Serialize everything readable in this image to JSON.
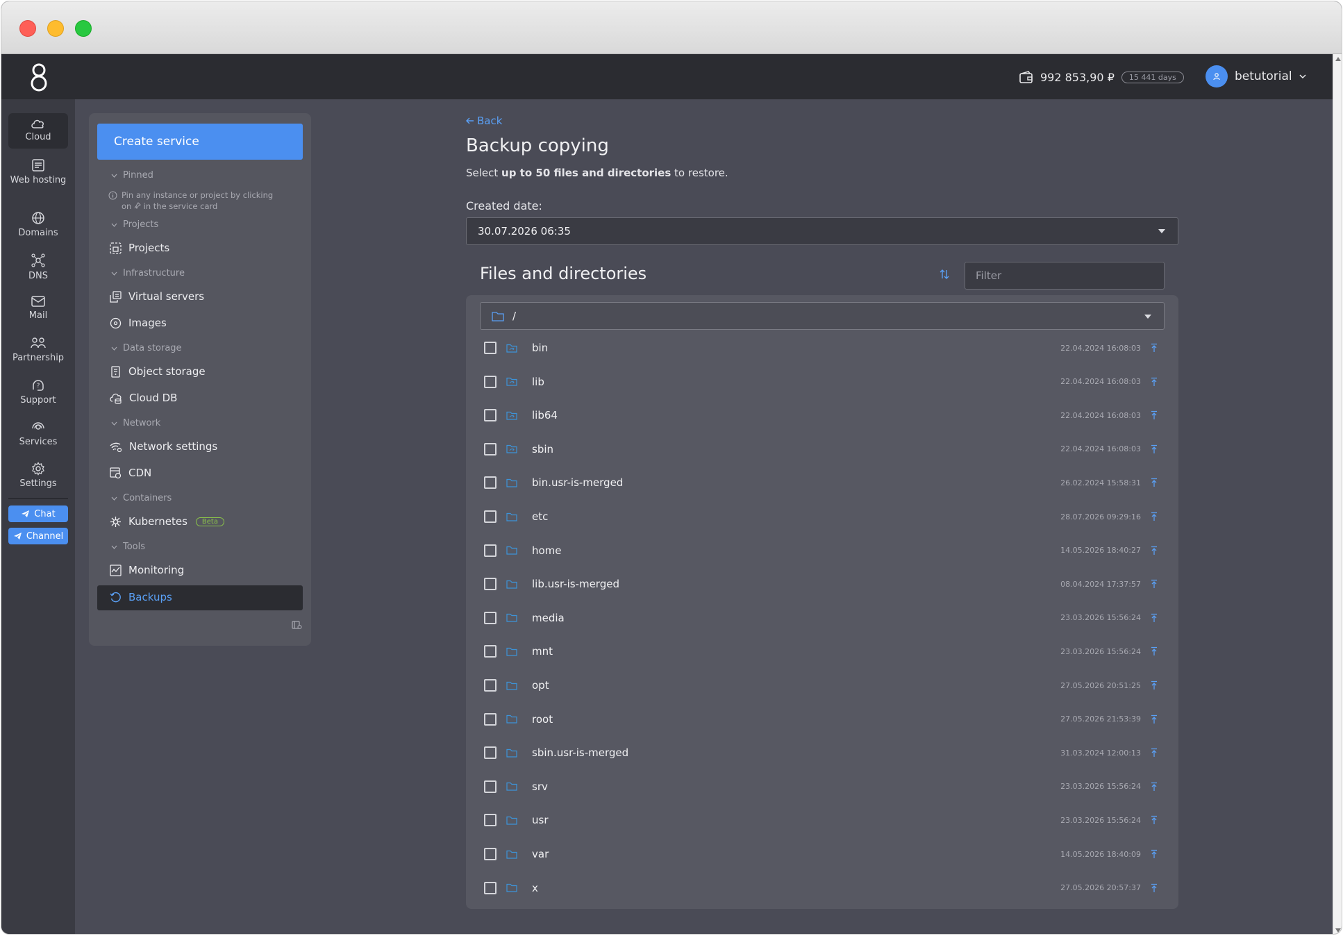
{
  "topbar": {
    "logo_icon": "brand-logo",
    "balance": "992 853,90 ₽",
    "days": "15 441 days",
    "username": "betutorial"
  },
  "rail": {
    "items": [
      {
        "label": "Cloud",
        "icon": "cloud-icon"
      },
      {
        "label": "Web hosting",
        "icon": "web-hosting-icon"
      },
      {
        "label": "Domains",
        "icon": "globe-icon"
      },
      {
        "label": "DNS",
        "icon": "dns-icon"
      },
      {
        "label": "Mail",
        "icon": "mail-icon"
      },
      {
        "label": "Partnership",
        "icon": "partnership-icon"
      },
      {
        "label": "Support",
        "icon": "support-icon"
      },
      {
        "label": "Services",
        "icon": "services-icon"
      },
      {
        "label": "Settings",
        "icon": "gear-icon"
      }
    ],
    "chat_label": "Chat",
    "channel_label": "Channel"
  },
  "sidebar": {
    "create_label": "Create service",
    "sections": {
      "pinned": "Pinned",
      "pinned_hint_1": "Pin any instance or project by clicking",
      "pinned_hint_2": "on",
      "pinned_hint_3": "in the service card",
      "projects": "Projects",
      "infrastructure": "Infrastructure",
      "data_storage": "Data storage",
      "network": "Network",
      "containers": "Containers",
      "tools": "Tools"
    },
    "items": {
      "projects": "Projects",
      "virtual_servers": "Virtual servers",
      "images": "Images",
      "object_storage": "Object storage",
      "cloud_db": "Cloud DB",
      "network_settings": "Network settings",
      "cdn": "CDN",
      "kubernetes": "Kubernetes",
      "beta": "Beta",
      "monitoring": "Monitoring",
      "backups": "Backups"
    }
  },
  "main": {
    "back": "Back",
    "title": "Backup copying",
    "subtitle_pre": "Select ",
    "subtitle_bold": "up to 50 files and directories",
    "subtitle_post": " to restore.",
    "created_label": "Created date:",
    "created_value": "30.07.2026 06:35",
    "files_title": "Files and directories",
    "filter_placeholder": "Filter",
    "path": "/",
    "files": [
      {
        "name": "bin",
        "date": "22.04.2024 16:08:03",
        "link": true
      },
      {
        "name": "lib",
        "date": "22.04.2024 16:08:03",
        "link": true
      },
      {
        "name": "lib64",
        "date": "22.04.2024 16:08:03",
        "link": true
      },
      {
        "name": "sbin",
        "date": "22.04.2024 16:08:03",
        "link": true
      },
      {
        "name": "bin.usr-is-merged",
        "date": "26.02.2024 15:58:31",
        "link": false
      },
      {
        "name": "etc",
        "date": "28.07.2026 09:29:16",
        "link": false
      },
      {
        "name": "home",
        "date": "14.05.2026 18:40:27",
        "link": false
      },
      {
        "name": "lib.usr-is-merged",
        "date": "08.04.2024 17:37:57",
        "link": false
      },
      {
        "name": "media",
        "date": "23.03.2026 15:56:24",
        "link": false
      },
      {
        "name": "mnt",
        "date": "23.03.2026 15:56:24",
        "link": false
      },
      {
        "name": "opt",
        "date": "27.05.2026 20:51:25",
        "link": false
      },
      {
        "name": "root",
        "date": "27.05.2026 21:53:39",
        "link": false
      },
      {
        "name": "sbin.usr-is-merged",
        "date": "31.03.2024 12:00:13",
        "link": false
      },
      {
        "name": "srv",
        "date": "23.03.2026 15:56:24",
        "link": false
      },
      {
        "name": "usr",
        "date": "23.03.2026 15:56:24",
        "link": false
      },
      {
        "name": "var",
        "date": "14.05.2026 18:40:09",
        "link": false
      },
      {
        "name": "x",
        "date": "27.05.2026 20:57:37",
        "link": false
      }
    ]
  },
  "colors": {
    "accent": "#4b8ff0",
    "topbar": "#2b2c31",
    "background": "#4a4b56",
    "panel": "#55565f",
    "beta": "#8bc34a"
  }
}
